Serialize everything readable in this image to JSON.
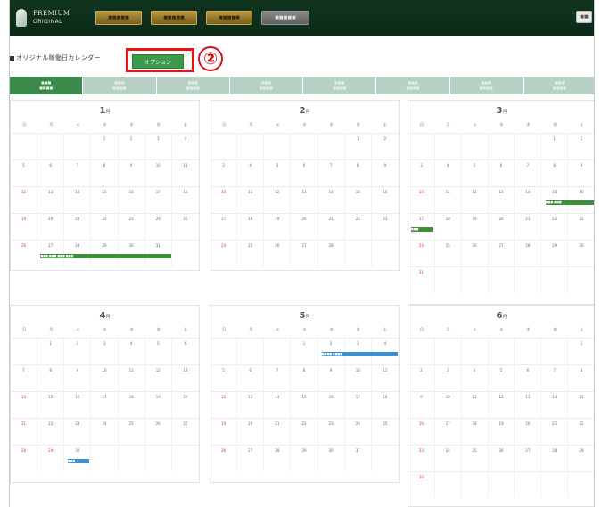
{
  "header": {
    "logo_line1": "PREMIUM",
    "logo_line2": "ORIGINAL",
    "nav": [
      {
        "label": "■■■■■",
        "style": "gold"
      },
      {
        "label": "■■■■■",
        "style": "gold"
      },
      {
        "label": "■■■■■",
        "style": "gold"
      },
      {
        "label": "■■■■■",
        "style": "grey"
      }
    ],
    "right_button": "■■"
  },
  "page": {
    "title": "オリジナル稼働日カレンダー",
    "options_button": "オプション",
    "badge": "②"
  },
  "tabs": [
    {
      "line1": "■■■",
      "line2": "■■■■"
    },
    {
      "line1": "■■■",
      "line2": "■■■■"
    },
    {
      "line1": "■■■",
      "line2": "■■■■"
    },
    {
      "line1": "■■■",
      "line2": "■■■■"
    },
    {
      "line1": "■■■",
      "line2": "■■■■"
    },
    {
      "line1": "■■■",
      "line2": "■■■■"
    },
    {
      "line1": "■■■",
      "line2": "■■■■"
    },
    {
      "line1": "■■■",
      "line2": "■■■■"
    }
  ],
  "weekdays": [
    "日",
    "月",
    "火",
    "水",
    "木",
    "金",
    "土"
  ],
  "months": [
    {
      "title": "1",
      "suffix": "月",
      "start": 3,
      "days": 31,
      "red": [
        4,
        11
      ],
      "events": [
        {
          "row": 4,
          "from": 1,
          "to": 5,
          "label": "■■■ ■■■ ■■■ ■■■",
          "color": "green"
        }
      ]
    },
    {
      "title": "2",
      "suffix": "月",
      "start": 5,
      "days": 28,
      "red": [
        11
      ],
      "events": []
    },
    {
      "title": "3",
      "suffix": "月",
      "start": 5,
      "days": 31,
      "red": [
        21
      ],
      "events": [
        {
          "row": 2,
          "from": 5,
          "to": 6,
          "label": "■■■ ■■■",
          "color": "green"
        },
        {
          "row": 3,
          "from": 0,
          "to": 0,
          "label": "■■■",
          "color": "green"
        }
      ]
    },
    {
      "title": "4",
      "suffix": "月",
      "start": 1,
      "days": 30,
      "red": [
        29
      ],
      "events": [
        {
          "row": 4,
          "from": 2,
          "to": 2,
          "label": "■■■",
          "color": "blue"
        }
      ]
    },
    {
      "title": "5",
      "suffix": "月",
      "start": 3,
      "days": 31,
      "red": [
        3,
        4,
        5,
        6
      ],
      "events": [
        {
          "row": 0,
          "from": 4,
          "to": 6,
          "label": "■■■■ ■■■■",
          "color": "blue"
        }
      ]
    },
    {
      "title": "6",
      "suffix": "月",
      "start": 6,
      "days": 30,
      "red": [],
      "events": []
    }
  ]
}
